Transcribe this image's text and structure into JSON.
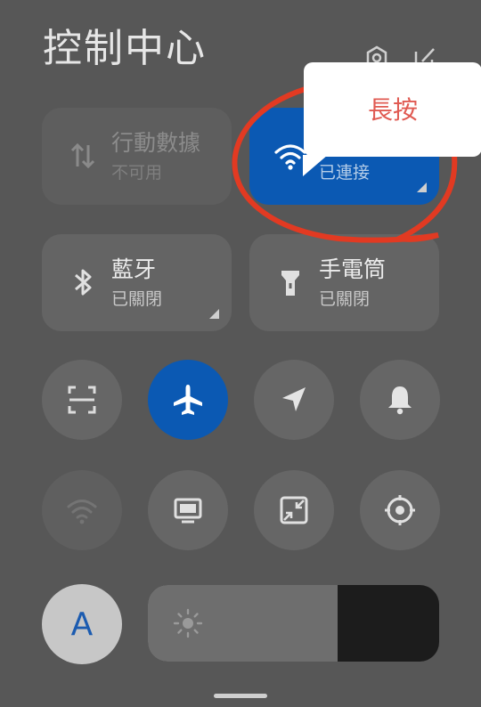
{
  "header": {
    "title": "控制中心",
    "icons": [
      "settings-hex-icon",
      "edit-icon"
    ]
  },
  "tiles": [
    {
      "id": "mobile-data",
      "name": "行動數據",
      "status": "不可用",
      "icon": "data-arrows-icon",
      "state": "disabled"
    },
    {
      "id": "wifi",
      "name": "",
      "status": "已連接",
      "icon": "wifi-icon",
      "state": "active"
    },
    {
      "id": "bluetooth",
      "name": "藍牙",
      "status": "已關閉",
      "icon": "bluetooth-icon",
      "state": "off"
    },
    {
      "id": "flashlight",
      "name": "手電筒",
      "status": "已關閉",
      "icon": "flashlight-icon",
      "state": "off"
    }
  ],
  "toggles_row1": [
    {
      "id": "scanner",
      "icon": "scan-icon",
      "state": "off"
    },
    {
      "id": "airplane",
      "icon": "airplane-icon",
      "state": "on"
    },
    {
      "id": "location",
      "icon": "location-arrow-icon",
      "state": "off"
    },
    {
      "id": "bell",
      "icon": "bell-icon",
      "state": "off"
    }
  ],
  "toggles_row2": [
    {
      "id": "hotspot",
      "icon": "wifi-hotspot-icon",
      "state": "dim"
    },
    {
      "id": "cast",
      "icon": "screen-cast-icon",
      "state": "off"
    },
    {
      "id": "resize",
      "icon": "shrink-screen-icon",
      "state": "off"
    },
    {
      "id": "target",
      "icon": "target-icon",
      "state": "off"
    }
  ],
  "brightness": {
    "auto_label": "A",
    "level": 0.65,
    "icon": "sun-icon"
  },
  "annotation": {
    "callout_text": "長按",
    "ring_color": "#e23a22"
  },
  "colors": {
    "background": "#575757",
    "accent": "#0b59b3",
    "callout_text": "#e05a52"
  }
}
